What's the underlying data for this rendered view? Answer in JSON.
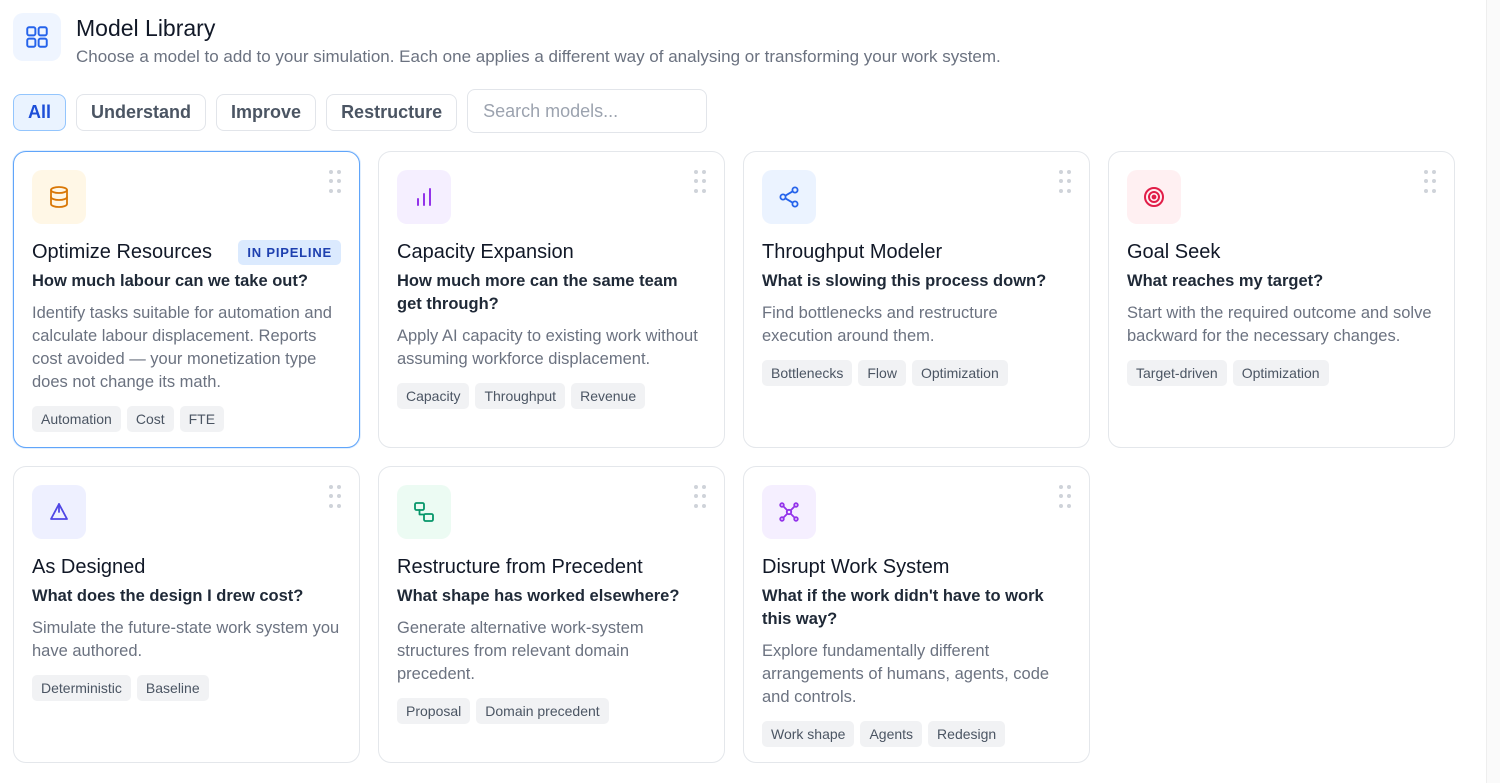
{
  "header": {
    "title": "Model Library",
    "subtitle": "Choose a model to add to your simulation. Each one applies a different way of analysing or transforming your work system.",
    "icon": "grid-icon"
  },
  "filters": {
    "chips": [
      {
        "label": "All",
        "active": true
      },
      {
        "label": "Understand",
        "active": false
      },
      {
        "label": "Improve",
        "active": false
      },
      {
        "label": "Restructure",
        "active": false
      }
    ],
    "search": {
      "placeholder": "Search models...",
      "value": ""
    }
  },
  "colors": {
    "accent": "#1d4ed8",
    "selected_border": "#60a5fa"
  },
  "cards": [
    {
      "title": "Optimize Resources",
      "badge": "IN PIPELINE",
      "question": "How much labour can we take out?",
      "description": "Identify tasks suitable for automation and calculate labour displacement. Reports cost avoided — your monetization type does not change its math.",
      "tags": [
        "Automation",
        "Cost",
        "FTE"
      ],
      "icon": "database-icon",
      "icon_color": "#d97706",
      "icon_bg": "#fff7e6",
      "selected": true
    },
    {
      "title": "Capacity Expansion",
      "badge": "",
      "question": "How much more can the same team get through?",
      "description": "Apply AI capacity to existing work without assuming workforce displacement.",
      "tags": [
        "Capacity",
        "Throughput",
        "Revenue"
      ],
      "icon": "bar-chart-icon",
      "icon_color": "#9333ea",
      "icon_bg": "#f5efff",
      "selected": false
    },
    {
      "title": "Throughput Modeler",
      "badge": "",
      "question": "What is slowing this process down?",
      "description": "Find bottlenecks and restructure execution around them.",
      "tags": [
        "Bottlenecks",
        "Flow",
        "Optimization"
      ],
      "icon": "share-icon",
      "icon_color": "#2563eb",
      "icon_bg": "#ebf3ff",
      "selected": false
    },
    {
      "title": "Goal Seek",
      "badge": "",
      "question": "What reaches my target?",
      "description": "Start with the required outcome and solve backward for the necessary changes.",
      "tags": [
        "Target-driven",
        "Optimization"
      ],
      "icon": "target-icon",
      "icon_color": "#e11d48",
      "icon_bg": "#fff0f2",
      "selected": false
    },
    {
      "title": "As Designed",
      "badge": "",
      "question": "What does the design I drew cost?",
      "description": "Simulate the future-state work system you have authored.",
      "tags": [
        "Deterministic",
        "Baseline"
      ],
      "icon": "pen-tool-icon",
      "icon_color": "#4f46e5",
      "icon_bg": "#eef0ff",
      "selected": false
    },
    {
      "title": "Restructure from Precedent",
      "badge": "",
      "question": "What shape has worked elsewhere?",
      "description": "Generate alternative work-system structures from relevant domain precedent.",
      "tags": [
        "Proposal",
        "Domain precedent"
      ],
      "icon": "workflow-icon",
      "icon_color": "#059669",
      "icon_bg": "#ecfbf3",
      "selected": false
    },
    {
      "title": "Disrupt Work System",
      "badge": "",
      "question": "What if the work didn't have to work this way?",
      "description": "Explore fundamentally different arrangements of humans, agents, code and controls.",
      "tags": [
        "Work shape",
        "Agents",
        "Redesign"
      ],
      "icon": "network-icon",
      "icon_color": "#9333ea",
      "icon_bg": "#f5efff",
      "selected": false
    }
  ]
}
